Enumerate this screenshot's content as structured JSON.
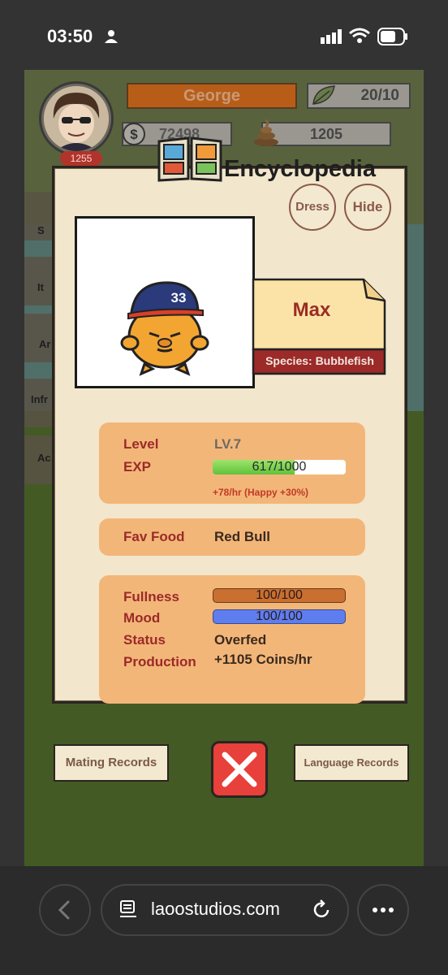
{
  "status_bar": {
    "time": "03:50"
  },
  "hud": {
    "player_name": "George",
    "player_level": "1255",
    "leaves": "20/10",
    "coins": "72498",
    "poop": "1205"
  },
  "side_menu": {
    "item_labels": [
      "S",
      "It",
      "Ar",
      "Infr",
      "Ac"
    ]
  },
  "encyclopedia": {
    "title": "Encyclopedia",
    "dress_label": "Dress",
    "hide_label": "Hide",
    "pet": {
      "name": "Max",
      "species": "Species: Bubblefish",
      "cap_number": "33"
    },
    "level_label": "Level",
    "level_value": "LV.7",
    "exp_label": "EXP",
    "exp_value": "617/1000",
    "exp_fraction": 0.617,
    "exp_rate": "+78/hr  (Happy +30%)",
    "fav_food_label": "Fav Food",
    "fav_food_value": "Red Bull",
    "fullness_label": "Fullness",
    "fullness_value": "100/100",
    "mood_label": "Mood",
    "mood_value": "100/100",
    "status_label": "Status",
    "status_value": "Overfed",
    "production_label": "Production",
    "production_value": "+1105 Coins/hr"
  },
  "bottom": {
    "mating_records": "Mating Records",
    "language_records": "Language Records"
  },
  "browser": {
    "url": "laoostudios.com"
  },
  "colors": {
    "panel": "#f2e6cc",
    "info_box": "#f3b679",
    "label": "#9b2a28",
    "close_button": "#e8403a",
    "fullness": "#c96f2f",
    "mood": "#5e7ef0",
    "exp": "#5fc23a"
  }
}
